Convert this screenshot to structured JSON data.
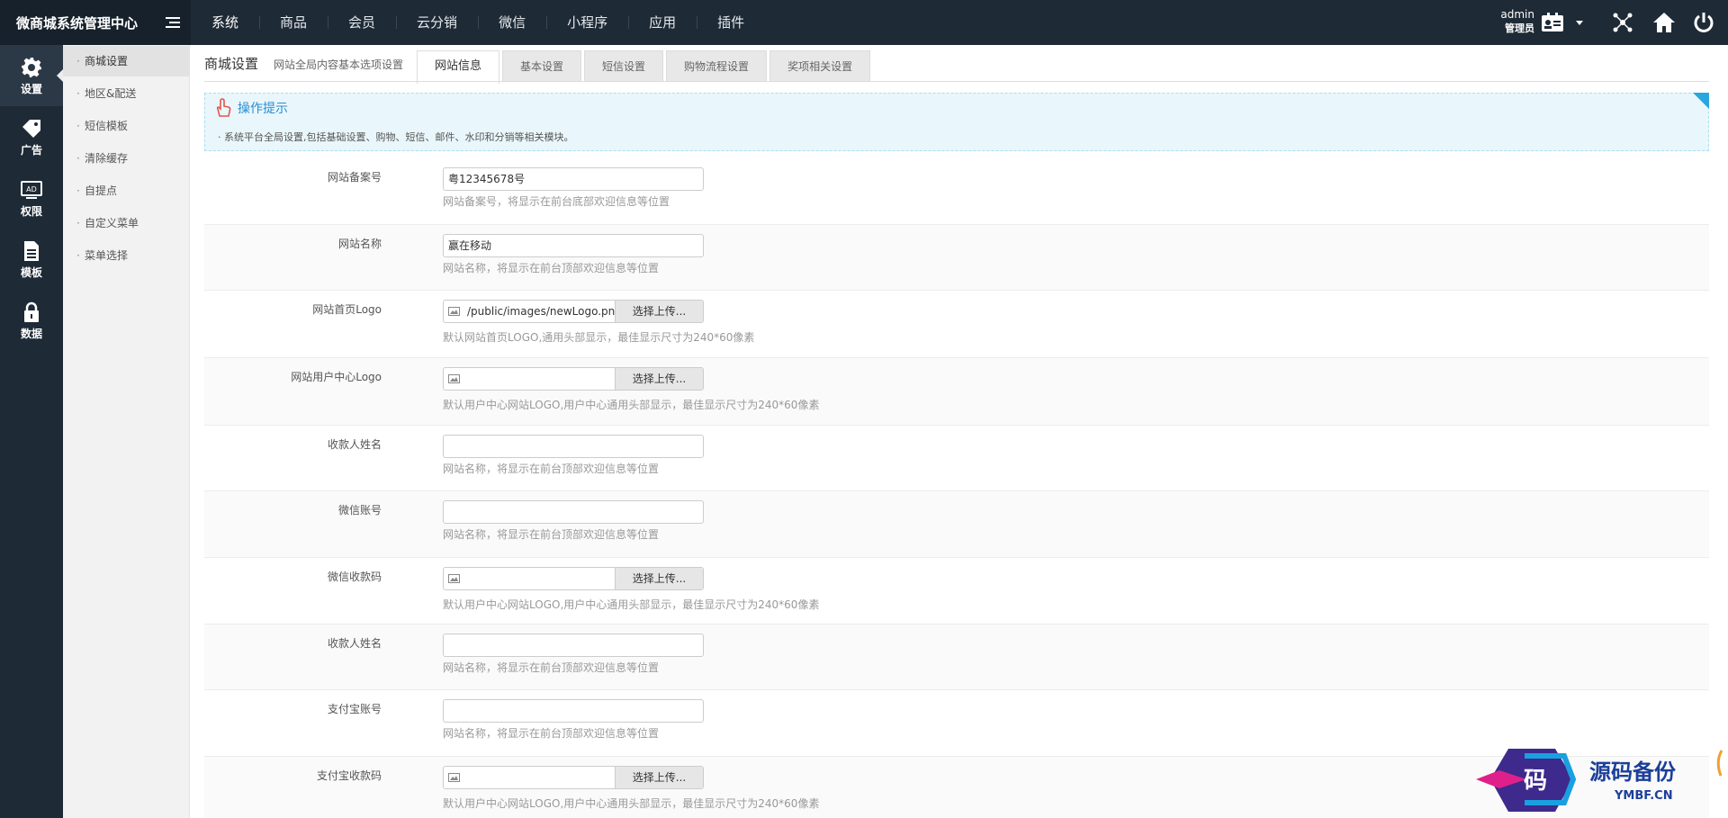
{
  "app": {
    "title": "微商城系统管理中心"
  },
  "topnav": [
    "系统",
    "商品",
    "会员",
    "云分销",
    "微信",
    "小程序",
    "应用",
    "插件"
  ],
  "user": {
    "name": "admin",
    "role": "管理员"
  },
  "icons": {
    "menu_toggle": "menu-toggle-icon",
    "admin_card": "id-card-icon",
    "dropdown": "caret-down-icon",
    "network": "network-icon",
    "home": "home-icon",
    "logout": "power-icon"
  },
  "rail": [
    {
      "label": "设置",
      "icon": "gear-icon"
    },
    {
      "label": "广告",
      "icon": "tag-icon"
    },
    {
      "label": "权限",
      "icon": "ad-icon"
    },
    {
      "label": "模板",
      "icon": "file-icon"
    },
    {
      "label": "数据",
      "icon": "lock-icon"
    }
  ],
  "submenu": [
    "商城设置",
    "地区&配送",
    "短信模板",
    "清除缓存",
    "自提点",
    "自定义菜单",
    "菜单选择"
  ],
  "page": {
    "title": "商城设置",
    "subtitle": "网站全局内容基本选项设置",
    "tabs": [
      "网站信息",
      "基本设置",
      "短信设置",
      "购物流程设置",
      "奖项相关设置"
    ]
  },
  "tip": {
    "title": "操作提示",
    "text": "系统平台全局设置,包括基础设置、购物、短信、邮件、水印和分销等相关模块。"
  },
  "form": {
    "upload_label": "选择上传...",
    "rows": [
      {
        "label": "网站备案号",
        "value": "粤12345678号",
        "hint": "网站备案号，将显示在前台底部欢迎信息等位置"
      },
      {
        "label": "网站名称",
        "value": "赢在移动",
        "hint": "网站名称，将显示在前台顶部欢迎信息等位置"
      },
      {
        "label": "网站首页Logo",
        "value": "/public/images/newLogo.png",
        "hint": "默认网站首页LOGO,通用头部显示，最佳显示尺寸为240*60像素"
      },
      {
        "label": "网站用户中心Logo",
        "value": "",
        "hint": "默认用户中心网站LOGO,用户中心通用头部显示，最佳显示尺寸为240*60像素"
      },
      {
        "label": "收款人姓名",
        "value": "",
        "hint": "网站名称，将显示在前台顶部欢迎信息等位置"
      },
      {
        "label": "微信账号",
        "value": "",
        "hint": "网站名称，将显示在前台顶部欢迎信息等位置"
      },
      {
        "label": "微信收款码",
        "value": "",
        "hint": "默认用户中心网站LOGO,用户中心通用头部显示，最佳显示尺寸为240*60像素"
      },
      {
        "label": "收款人姓名",
        "value": "",
        "hint": "网站名称，将显示在前台顶部欢迎信息等位置"
      },
      {
        "label": "支付宝账号",
        "value": "",
        "hint": "网站名称，将显示在前台顶部欢迎信息等位置"
      },
      {
        "label": "支付宝收款码",
        "value": "",
        "hint": "默认用户中心网站LOGO,用户中心通用头部显示，最佳显示尺寸为240*60像素"
      }
    ]
  },
  "watermark": {
    "text": "源码备份",
    "domain": "YMBF.CN",
    "glyph": "码"
  },
  "colors": {
    "topbar": "#1e2a36",
    "accent": "#2a8fd0",
    "tip_bg": "#e9f6fb"
  }
}
